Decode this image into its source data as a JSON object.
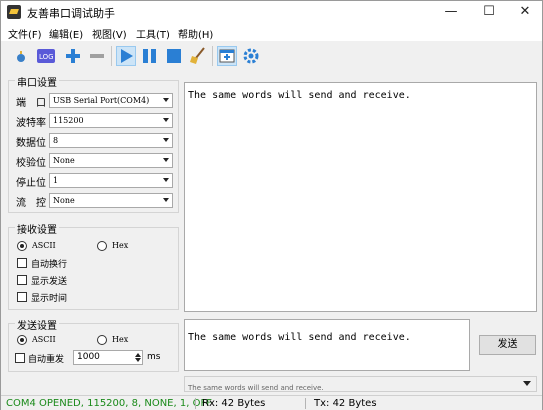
{
  "window": {
    "title": "友善串口调试助手"
  },
  "menu": [
    "文件(F)",
    "编辑(E)",
    "视图(V)",
    "工具(T)",
    "帮助(H)"
  ],
  "toolbar": {
    "icons": [
      "open-icon",
      "log-icon",
      "add-icon",
      "remove-icon",
      "play-icon",
      "pause-icon",
      "stop-icon",
      "clear-broom-icon",
      "new-window-icon",
      "settings-gear-icon"
    ]
  },
  "serial": {
    "title": "串口设置",
    "port_label": "端　口",
    "port": "USB Serial Port(COM4)",
    "baud_label": "波特率",
    "baud": "115200",
    "databits_label": "数据位",
    "databits": "8",
    "parity_label": "校验位",
    "parity": "None",
    "stopbits_label": "停止位",
    "stopbits": "1",
    "flow_label": "流　控",
    "flow": "None"
  },
  "receive": {
    "title": "接收设置",
    "ascii": "ASCII",
    "hex": "Hex",
    "autowrap": "自动换行",
    "show_send": "显示发送",
    "show_time": "显示时间",
    "text": "The same words will send and receive."
  },
  "send": {
    "title": "发送设置",
    "ascii": "ASCII",
    "hex": "Hex",
    "auto_resend": "自动重发",
    "interval": "1000",
    "unit": "ms",
    "text": "The same words will send and receive.",
    "button": "发送",
    "history": "The same words will send and receive."
  },
  "status": {
    "connection": "COM4 OPENED, 115200, 8, NONE, 1, OFF",
    "rx": "Rx: 42 Bytes",
    "tx": "Tx: 42 Bytes"
  },
  "colors": {
    "accent": "#2a7fd4",
    "status_green": "#1a8a1a"
  }
}
